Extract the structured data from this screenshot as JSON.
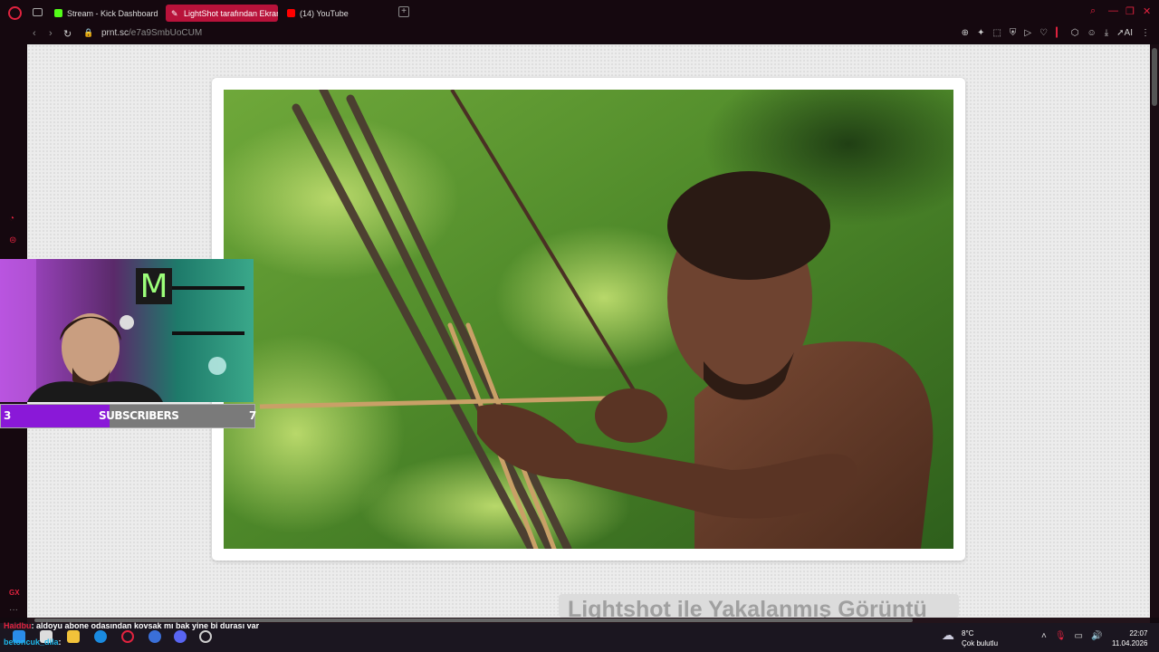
{
  "tabs": [
    {
      "label": "Stream - Kick Dashboard",
      "active": false,
      "favicon_color": "#53fc18"
    },
    {
      "label": "LightShot tarafından Ekran",
      "active": true,
      "favicon_color": "#ffffff"
    },
    {
      "label": "(14) YouTube",
      "active": false,
      "favicon_color": "#ff0000"
    }
  ],
  "address": {
    "domain": "prnt.sc",
    "path": "/e7a9SmbUoCUM"
  },
  "caption": "Lightshot ile Yakalanmış Görüntü",
  "subscribers": {
    "title": "SUBSCRIBERS",
    "current": "3",
    "goal": "7",
    "progress": 0.43
  },
  "chat": [
    {
      "user": "Haidbu",
      "message": ": aldoyu abone odasından kovsak mı bak yine bi durası var"
    },
    {
      "user": "betoncuk_dila",
      "message": ":"
    }
  ],
  "sidebar_label": "GX",
  "taskbar": {
    "weather_temp": "8°C",
    "weather_desc": "Çok bulutlu",
    "time": "22:07",
    "date": "11.04.2026"
  },
  "toolbar": {
    "ai_label": "AI"
  },
  "colors": {
    "accent": "#e0233f",
    "active_tab": "#b8123a",
    "sub_fill": "#8a18d8"
  }
}
